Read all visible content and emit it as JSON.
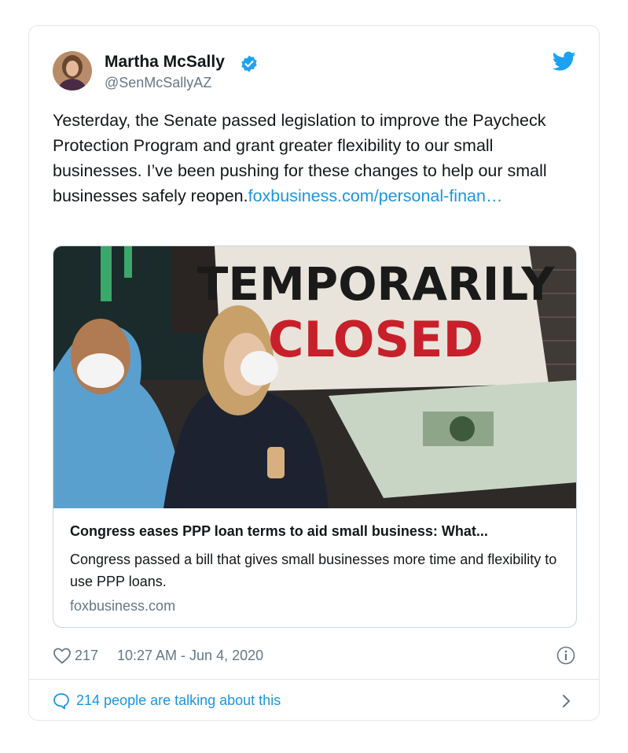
{
  "tweet": {
    "author_name": "Martha McSally",
    "author_handle": "@SenMcSallyAZ",
    "text_body": "Yesterday, the Senate passed legislation to improve the Paycheck Protection Program and grant greater flexibility to our small businesses. I’ve been pushing for these changes to help our small businesses safely reopen.",
    "link_text": "foxbusiness.com/personal-finan…",
    "likes": "217",
    "timestamp": "10:27 AM - Jun 4, 2020",
    "talking_about": "214 people are talking about this"
  },
  "link_card": {
    "image_sign_line1": "TEMPORARILY",
    "image_sign_line2": "CLOSED",
    "title": "Congress eases PPP loan terms to aid small business: What...",
    "description": "Congress passed a bill that gives small businesses more time and flexibility to use PPP loans.",
    "domain": "foxbusiness.com"
  },
  "colors": {
    "twitter_blue": "#1da1f2",
    "link_blue": "#1b95e0",
    "muted_gray": "#657786",
    "border": "#e1e8ed",
    "sign_red": "#c8202a"
  },
  "icons": [
    "verified-badge-icon",
    "twitter-bird-icon",
    "heart-icon",
    "info-icon",
    "speech-bubble-icon",
    "chevron-right-icon"
  ]
}
